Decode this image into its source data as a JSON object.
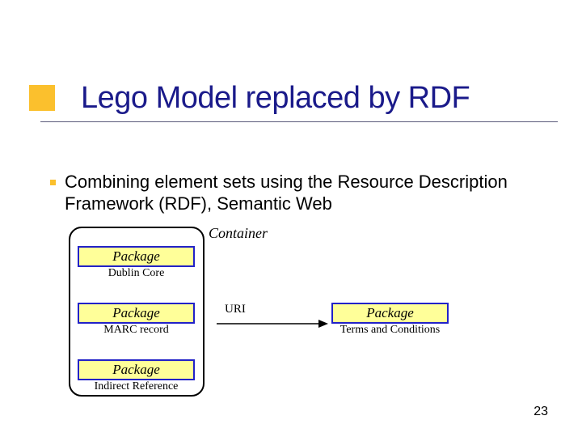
{
  "title": "Lego Model replaced by RDF",
  "body": "Combining element sets using the Resource Description Framework (RDF), Semantic Web",
  "diagram": {
    "container_label": "Container",
    "uri_label": "URI",
    "packages": {
      "p1": {
        "title": "Package",
        "sub": "Dublin Core"
      },
      "p2": {
        "title": "Package",
        "sub": "MARC record"
      },
      "p3": {
        "title": "Package",
        "sub": "Indirect Reference"
      },
      "pr": {
        "title": "Package",
        "sub": "Terms and Conditions"
      }
    }
  },
  "page_number": "23",
  "colors": {
    "accent": "#fbc02d",
    "title": "#1a1a8a",
    "pkg_border": "#2222c8",
    "pkg_fill": "#ffff99"
  }
}
